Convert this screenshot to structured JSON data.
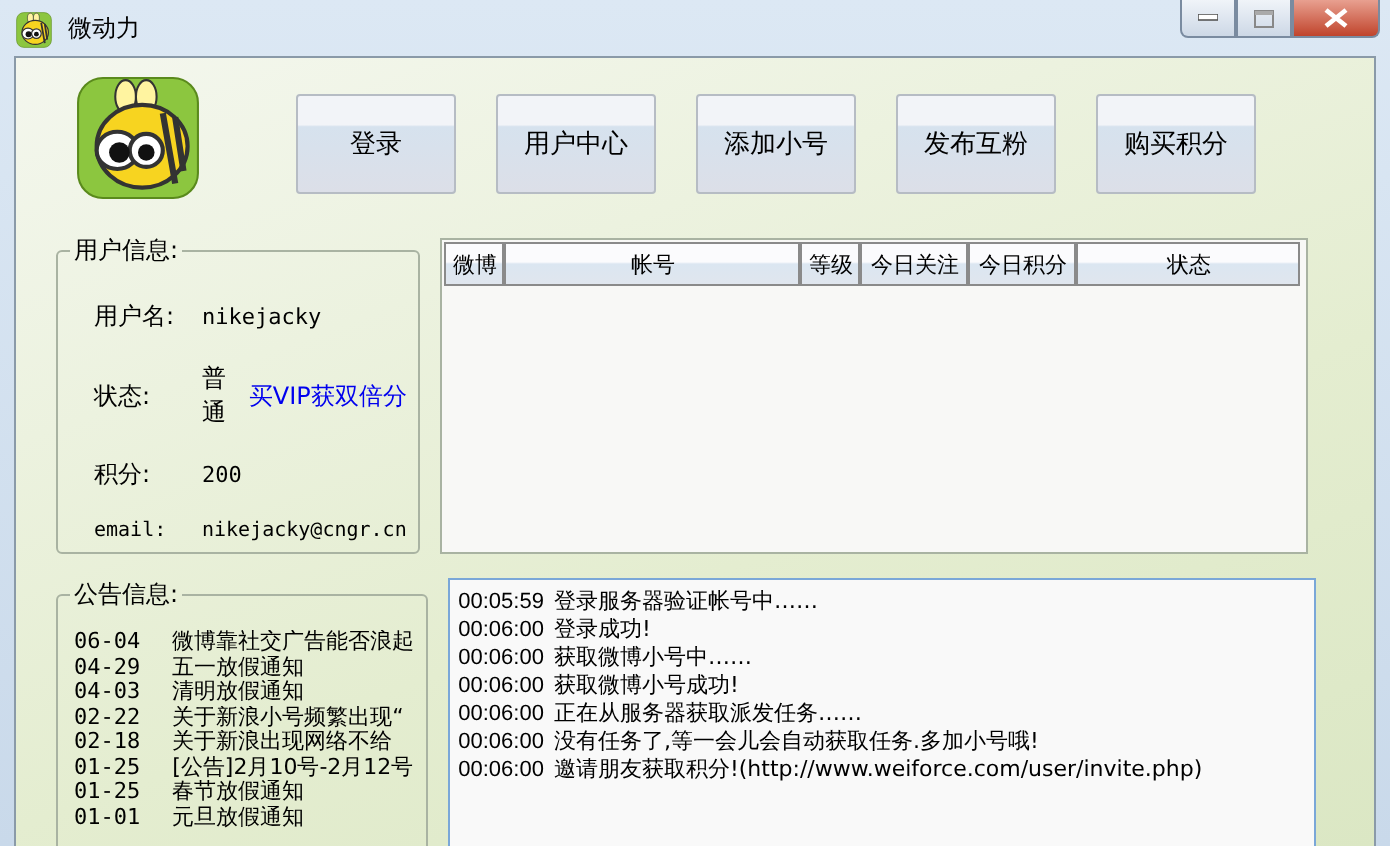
{
  "window": {
    "title": "微动力"
  },
  "toolbar": {
    "buttons": [
      "登录",
      "用户中心",
      "添加小号",
      "发布互粉",
      "购买积分"
    ]
  },
  "user_info": {
    "legend": "用户信息:",
    "fields": [
      {
        "kind": "text",
        "label": "用户名:",
        "value": "nikejacky"
      },
      {
        "kind": "status",
        "label": "状态:",
        "value": "普通",
        "link": "买VIP获双倍分"
      },
      {
        "kind": "text",
        "label": "积分:",
        "value": "200"
      },
      {
        "kind": "text",
        "label": "email:",
        "value": "nikejacky@cngr.cn"
      }
    ]
  },
  "table": {
    "columns": [
      "微博",
      "帐号",
      "等级",
      "今日关注",
      "今日积分",
      "状态"
    ]
  },
  "notices": {
    "legend": "公告信息:",
    "items": [
      {
        "date": "06-04",
        "title": "微博靠社交广告能否浪起"
      },
      {
        "date": "04-29",
        "title": "五一放假通知"
      },
      {
        "date": "04-03",
        "title": "清明放假通知"
      },
      {
        "date": "02-22",
        "title": "关于新浪小号频繁出现“"
      },
      {
        "date": "02-18",
        "title": "关于新浪出现网络不给"
      },
      {
        "date": "01-25",
        "title": "[公告]2月10号-2月12号"
      },
      {
        "date": "01-25",
        "title": "春节放假通知"
      },
      {
        "date": "01-01",
        "title": "元旦放假通知"
      }
    ]
  },
  "log": [
    {
      "time": "00:05:59",
      "message": "登录服务器验证帐号中……"
    },
    {
      "time": "00:06:00",
      "message": "登录成功!"
    },
    {
      "time": "00:06:00",
      "message": "获取微博小号中……"
    },
    {
      "time": "00:06:00",
      "message": "获取微博小号成功!"
    },
    {
      "time": "00:06:00",
      "message": "正在从服务器获取派发任务……"
    },
    {
      "time": "00:06:00",
      "message": "没有任务了,等一会儿会自动获取任务.多加小号哦!"
    },
    {
      "time": "00:06:00",
      "message": "邀请朋友获取积分!(http://www.weiforce.com/user/invite.php)"
    }
  ]
}
